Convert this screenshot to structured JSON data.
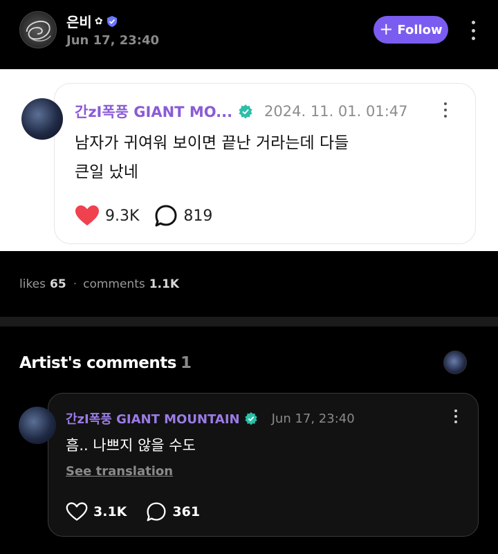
{
  "post": {
    "author_name": "은비",
    "time": "Jun 17, 23:40",
    "follow_label": "Follow"
  },
  "quote": {
    "author": "간zI폭풍 GIANT MO...",
    "date": "2024. 11. 01. 01:47",
    "text_line1": "남자가 귀여워 보이면 끝난 거라는데 다들",
    "text_line2": "큰일 났네",
    "likes": "9.3K",
    "comments": "819"
  },
  "counts": {
    "likes_label": "likes",
    "likes_value": "65",
    "separator": "·",
    "comments_label": "comments",
    "comments_value": "1.1K"
  },
  "artist_comments": {
    "title": "Artist's comments",
    "count": "1",
    "comment": {
      "author": "간zI폭풍 GIANT MOUNTAIN",
      "date": "Jun 17, 23:40",
      "text": "흠.. 나쁘지 않을 수도",
      "translate_label": "See translation",
      "likes": "3.1K",
      "replies": "361"
    }
  },
  "colors": {
    "accent": "#7b5cf0",
    "author_purple": "#8a5bd6",
    "heart_red": "#f0414f",
    "verified_teal": "#2bbfa8"
  }
}
